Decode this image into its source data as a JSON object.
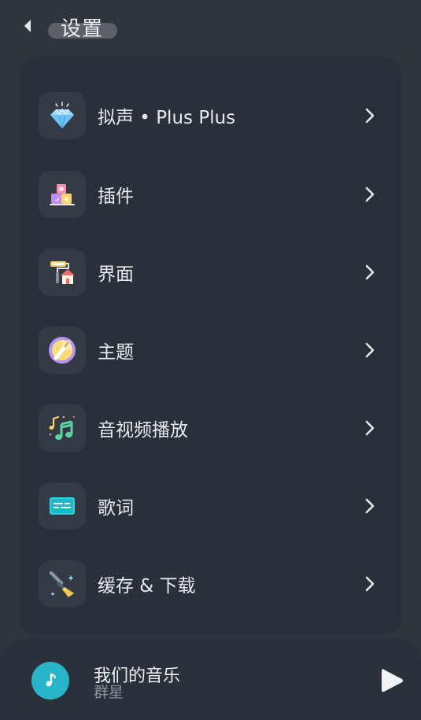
{
  "header": {
    "title": "设置",
    "back_icon": "back-arrow-icon"
  },
  "settings": {
    "items": [
      {
        "label": "拟声 • Plus Plus",
        "icon": "diamond-icon"
      },
      {
        "label": "插件",
        "icon": "blocks-icon"
      },
      {
        "label": "界面",
        "icon": "paint-roller-house-icon"
      },
      {
        "label": "主题",
        "icon": "theme-palette-icon"
      },
      {
        "label": "音视频播放",
        "icon": "music-notes-icon"
      },
      {
        "label": "歌词",
        "icon": "lyrics-screen-icon"
      },
      {
        "label": "缓存 & 下载",
        "icon": "broom-icon"
      }
    ]
  },
  "player": {
    "song_title": "我们的音乐",
    "artist": "群星",
    "album_icon": "music-note-icon",
    "play_icon": "play-icon"
  },
  "colors": {
    "background": "#2f353d",
    "card": "#2a3039",
    "tile": "#343a43",
    "text": "#e7ebf0",
    "accent_teal": "#29b5c8"
  }
}
